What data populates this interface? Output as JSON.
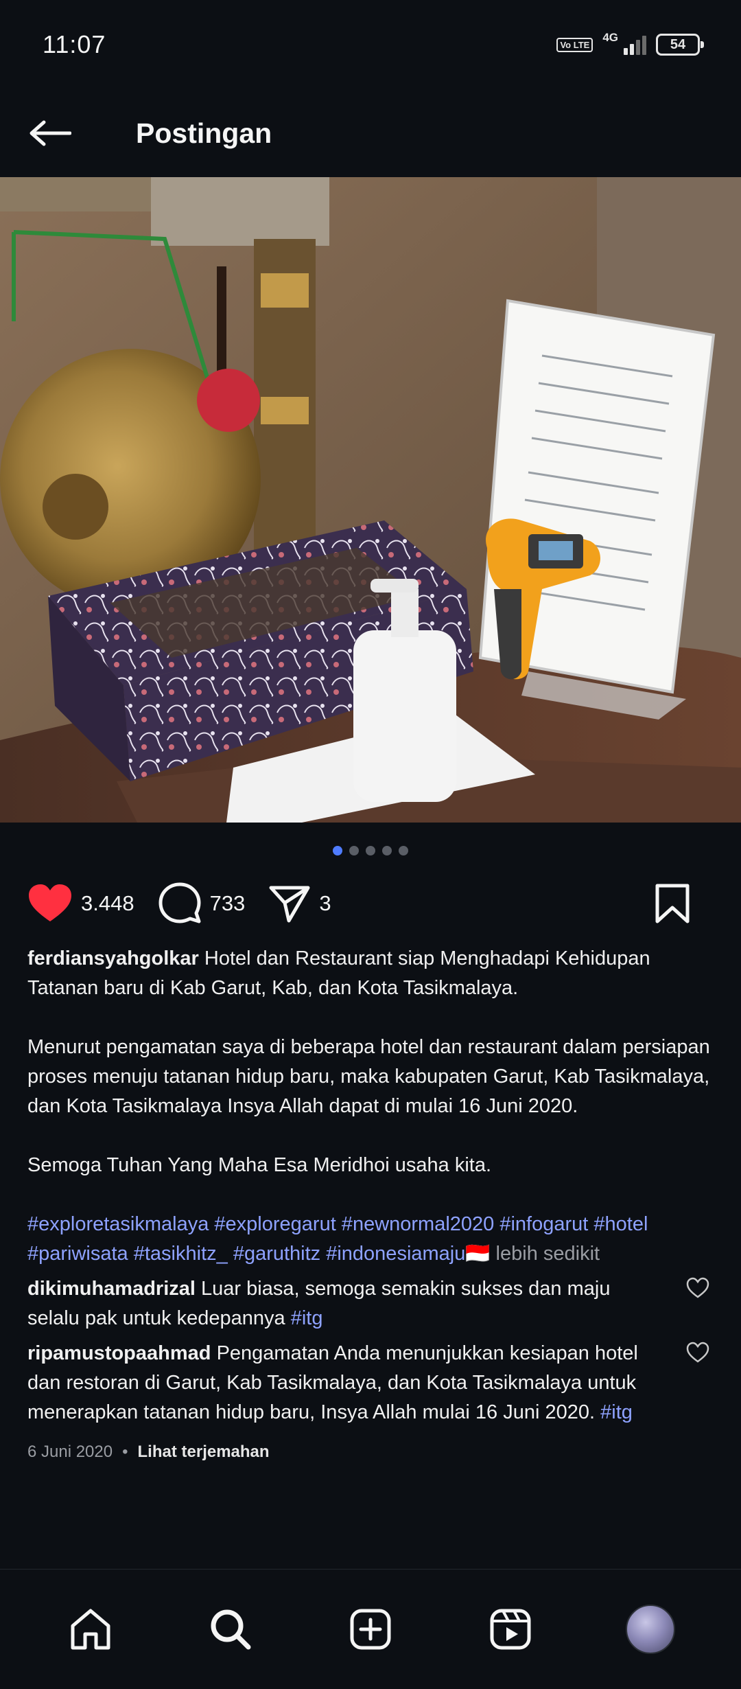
{
  "status_bar": {
    "time": "11:07",
    "volte": "Vo LTE",
    "network": "4G",
    "battery": "54"
  },
  "header": {
    "title": "Postingan"
  },
  "carousel": {
    "total": 5,
    "active": 1
  },
  "actions": {
    "likes": "3.448",
    "comments": "733",
    "shares": "3",
    "like_color": "#ff3040"
  },
  "caption": {
    "username": "ferdiansyahgolkar",
    "text1": "Hotel dan Restaurant siap Menghadapi Kehidupan Tatanan baru di Kab Garut, Kab, dan Kota Tasikmalaya.",
    "text2": "Menurut pengamatan saya di beberapa hotel dan restaurant dalam persiapan proses menuju tatanan hidup baru,  maka kabupaten Garut, Kab Tasikmalaya,  dan Kota Tasikmalaya Insya Allah dapat di mulai 16 Juni 2020.",
    "text3": "Semoga Tuhan Yang Maha Esa Meridhoi usaha kita.",
    "hashtags": "#exploretasikmalaya #exploregarut #newnormal2020 #infogarut #hotel #pariwisata #tasikhitz_ #garuthitz #indonesiamaju🇮🇩",
    "more": "lebih sedikit"
  },
  "comments": [
    {
      "username": "dikimuhamadrizal",
      "text": "Luar biasa, semoga semakin sukses dan maju selalu pak untuk kedepannya",
      "tag": "#itg"
    },
    {
      "username": "ripamustopaahmad",
      "text": "Pengamatan Anda menunjukkan kesiapan hotel dan restoran di Garut, Kab Tasikmalaya, dan Kota Tasikmalaya untuk menerapkan tatanan hidup baru, Insya Allah mulai 16 Juni 2020.",
      "tag": "#itg"
    }
  ],
  "meta": {
    "date": "6 Juni 2020",
    "separator": "•",
    "translate": "Lihat terjemahan"
  },
  "colors": {
    "background": "#0c0f14",
    "hashtag": "#8ea2ff",
    "accent_dot": "#4f7cff"
  },
  "nav_icons": [
    "home-icon",
    "search-icon",
    "create-icon",
    "reels-icon",
    "profile-avatar"
  ]
}
